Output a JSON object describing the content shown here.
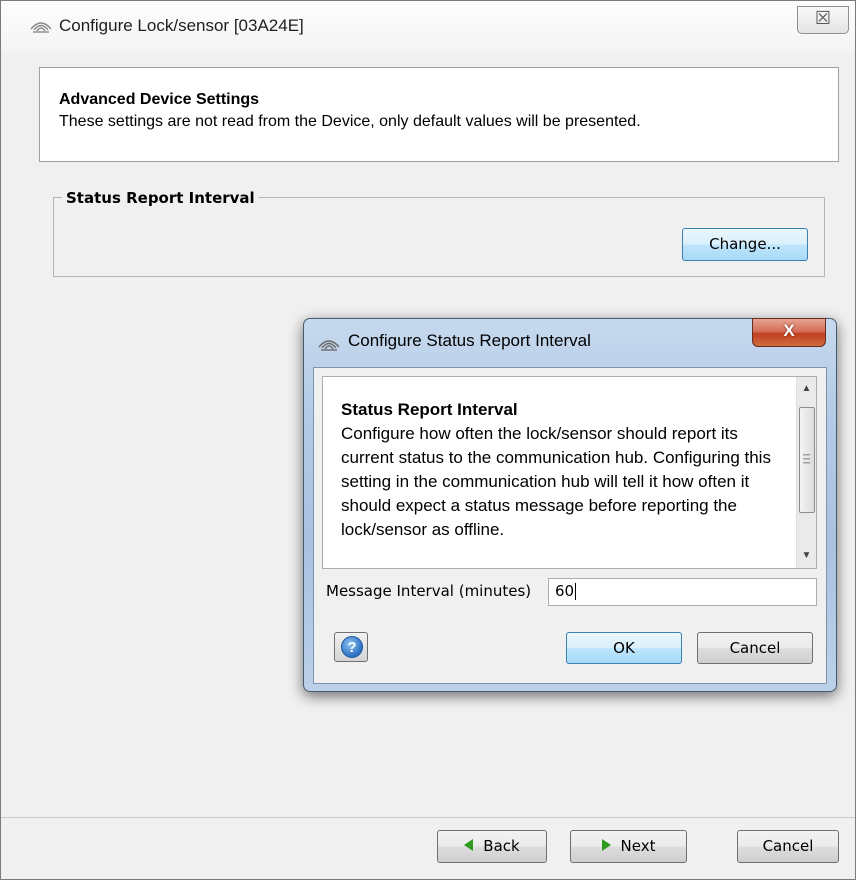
{
  "window": {
    "title": "Configure Lock/sensor [03A24E]",
    "close_glyph": "☒"
  },
  "header": {
    "title": "Advanced Device Settings",
    "description": "These settings are not read from the Device, only default values will be presented."
  },
  "status_group": {
    "legend": "Status Report Interval",
    "change_label": "Change..."
  },
  "footer": {
    "back_label": "Back",
    "next_label": "Next",
    "cancel_label": "Cancel"
  },
  "dialog": {
    "title": "Configure Status Report Interval",
    "close_glyph": "X",
    "description_title": "Status Report Interval",
    "description_body": "Configure how often the lock/sensor should report its current status to the communication hub. Configuring this setting in the communication hub will tell it how often it should expect a status message before reporting the lock/sensor as offline.",
    "interval_label": "Message Interval (minutes)",
    "interval_value": "60",
    "help_glyph": "?",
    "ok_label": "OK",
    "cancel_label": "Cancel"
  },
  "icons": {
    "window_icon": "signal-waves-icon",
    "help_icon": "help-icon",
    "back_icon": "arrow-left-icon",
    "next_icon": "arrow-right-icon"
  },
  "colors": {
    "dialog_frame": "#b4cbe6",
    "close_button": "#c1401f",
    "arrow_green": "#2f9a1e"
  }
}
